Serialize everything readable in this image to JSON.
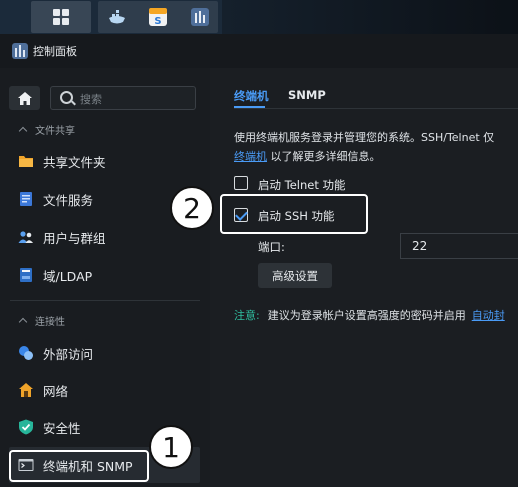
{
  "window": {
    "title": "控制面板"
  },
  "search": {
    "placeholder": "搜索"
  },
  "sidebar": {
    "sections": [
      {
        "header": "文件共享",
        "items": [
          "共享文件夹",
          "文件服务",
          "用户与群组",
          "域/LDAP"
        ]
      },
      {
        "header": "连接性",
        "items": [
          "外部访问",
          "网络",
          "安全性",
          "终端机和 SNMP"
        ]
      }
    ],
    "active_item": "终端机和 SNMP"
  },
  "tabs": [
    "终端机",
    "SNMP"
  ],
  "description": {
    "line1": "使用终端机服务登录并管理您的系统。SSH/Telnet 仅",
    "link": "终端机",
    "line2_rest": " 以了解更多详细信息。"
  },
  "options": {
    "telnet_label": "启动 Telnet 功能",
    "telnet_checked": false,
    "ssh_label": "启动 SSH 功能",
    "ssh_checked": true
  },
  "port": {
    "label": "端口:",
    "value": "22"
  },
  "advanced_button": "高级设置",
  "note": {
    "label": "注意:",
    "text": "建议为登录帐户设置高强度的密码并启用",
    "link": "自动封"
  },
  "callouts": [
    "1",
    "2"
  ],
  "colors": {
    "accent": "#4a9bf6",
    "note": "#2fbfa0",
    "background": "#16191d"
  }
}
